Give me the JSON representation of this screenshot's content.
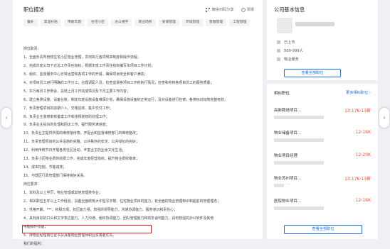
{
  "job": {
    "section_title": "职位描述",
    "share_label": "微信扫码分享",
    "report_label": "举报",
    "tags": [
      "餐补",
      "高温补贴",
      "带薪年假",
      "住宅小区",
      "办公楼宇",
      "商业场所",
      "安保管理",
      "环境管理",
      "客服管理",
      "工程管理"
    ],
    "description_lines": [
      "岗位职责：",
      "1、全面负责所管辖住宅小区物业管理，贯彻执行各项规章制度和操作流程；",
      "2、完成年度公司下达总工作责任指标，根据年度工作责任指标编写本项目工作计划；",
      "3、组织、监督服务中心日常运营和各项工作的开展，确保项目安全和客户满意；",
      "4、对项目员工进行明确的工作分工，合理调配人员，检查监督各项目工作的执行情况，检查和考核各项目员工的服务质量；",
      "5、实行每月工作例会，总结上月工作完成情况及下月主要工作内容；",
      "6、建立各类设施、设备台账，制定年度设施设备维保计划，确保设施设备的正常运行，及对设备进行检修，各类标识标牌完整有效；",
      "7、负责管理项目的前期介入、交楼验收、集中交付工作；",
      "8、负责业主装修审核备案工作和违规装修的处理工作；",
      "9、负责业主投诉的处理和回访工作，提升服务满意度；",
      "10、负责业主提供所需的维修接待等，开配合和监督维修部门的维修整改；",
      "11、负责管理项目的公共设施的完整、公共秩序的安定、公共绿化的完好；",
      "12、利用传统节日开展各类社区活动，丰富业主的业余文化生活；",
      "13、负责小区物业费的收费工作，完成年度经营指标，提升物业费收缴率；",
      "14、成本控制，节能减排；",
      "15、与辖区行政管理部门保持良好关系。",
      "岗位要求：",
      "1、本科及以上学历，物业管理或其他管理类专业；",
      "2、相关职位五年以上工作经验，具备全面统筹大中型写字楼、住宅物业项目的能力，有全面的物业管理知识和超前的管理理念；",
      "3、性格开朗、***、积极乐观，抗压能力强，较强的领导能力、沟通协调能力、服务意识和责任心；",
      "4、具有良好的口头和文字表达能力、人力沟通、组织协调能力、团队管理能力和商务谈判能力，具有较强的办公软件及其他",
      "电脑操作技能；",
      "5、持物业经理岗位证书及具备物业管理师职业资格者优先。",
      "我们的福利："
    ]
  },
  "company": {
    "section_title": "公司基本信息",
    "status": "已上市",
    "size": "500-999人",
    "industry": "物业服务",
    "all_jobs_button": "查看全部职位"
  },
  "similar": {
    "title": "相似职位",
    "more_link": "更多相似职位 ›",
    "items": [
      {
        "title": "高新聘请项目...",
        "salary": "13-17K·13薪",
        "sub": ""
      },
      {
        "title": "物业储备项目...",
        "salary": "12-16K",
        "sub": ""
      },
      {
        "title": "物业项目经理",
        "salary": "12-20K",
        "sub": ""
      },
      {
        "title": "物业苏州项目...",
        "salary": "13-17K·13薪",
        "sub": "···"
      },
      {
        "title": "医院物业项目...",
        "salary": "12-16K",
        "sub": ""
      }
    ],
    "all_button": "查看全部职位"
  }
}
